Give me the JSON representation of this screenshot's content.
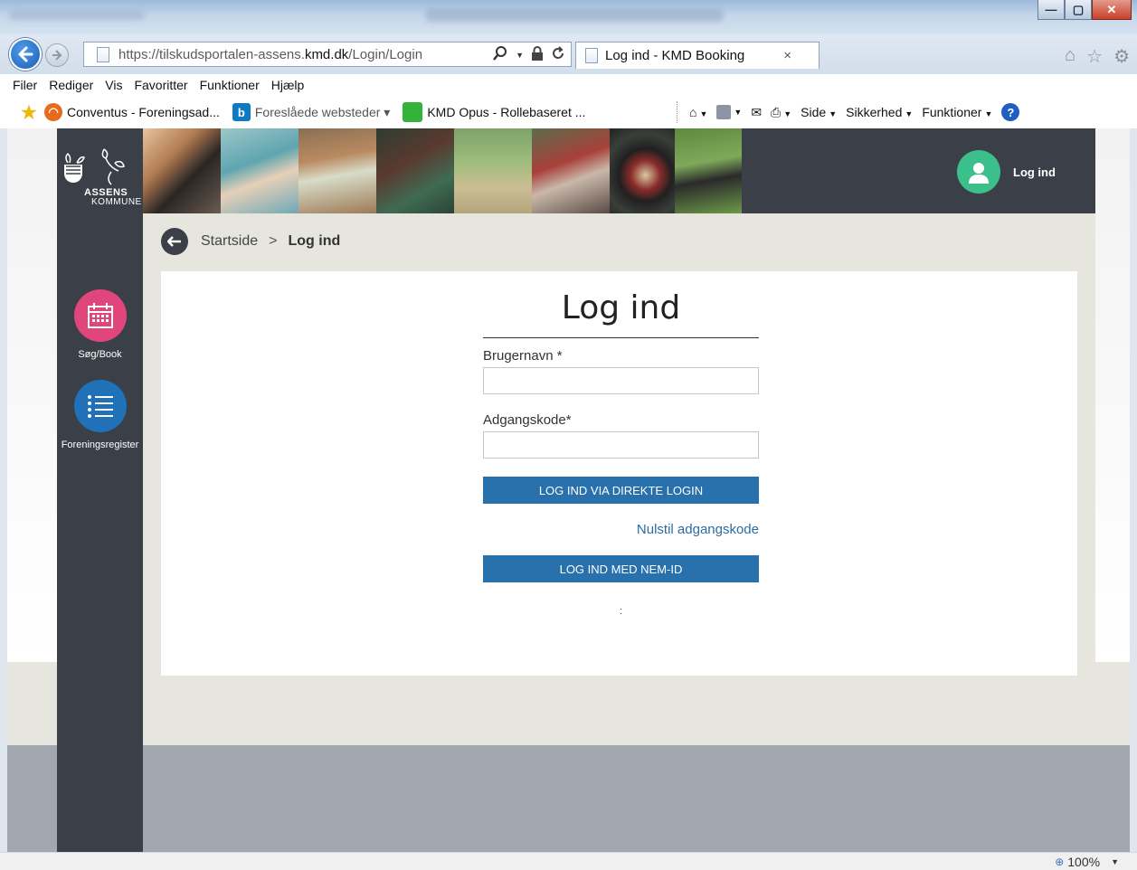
{
  "browser": {
    "url_prefix": "https://tilskudsportalen-assens.",
    "url_domain": "kmd.dk",
    "url_path": "/Login/Login",
    "tab_title": "Log ind - KMD Booking",
    "tab_close": "×",
    "search_glyph": "⚲",
    "menu": [
      "Filer",
      "Rediger",
      "Vis",
      "Favoritter",
      "Funktioner",
      "Hjælp"
    ],
    "favorites": [
      {
        "label": "Conventus - Foreningsad...",
        "icon": "conventus-icon",
        "color": "#e86a1a"
      },
      {
        "label": "Foreslåede websteder ▾",
        "icon": "bing-icon",
        "color": "#0f7ac0"
      },
      {
        "label": "KMD Opus - Rollebaseret ...",
        "icon": "kmd-icon",
        "color": "#33b33a"
      }
    ],
    "tools": {
      "side": "Side",
      "sikkerhed": "Sikkerhed",
      "funktioner": "Funktioner"
    },
    "zoom": "100%"
  },
  "site": {
    "logo_line1": "ASSENS",
    "logo_line2": "KOMMUNE",
    "login_link": "Log ind",
    "nav": [
      {
        "label": "Søg/Book",
        "icon": "calendar-icon",
        "color": "#e0467c"
      },
      {
        "label": "Foreningsregister",
        "icon": "list-icon",
        "color": "#2071b8"
      }
    ]
  },
  "breadcrumb": {
    "home": "Startside",
    "separator": ">",
    "current": "Log ind"
  },
  "login": {
    "title": "Log ind",
    "username_label": "Brugernavn *",
    "username_value": "",
    "password_label": "Adgangskode*",
    "password_value": "",
    "direct_login_button": "LOG IND VIA DIREKTE LOGIN",
    "reset_link": "Nulstil adgangskode",
    "nemid_button": "LOG IND MED NEM-ID",
    "footer_colon": ":"
  },
  "colors": {
    "sidebar": "#3b4048",
    "button": "#2871ac",
    "link": "#2b6ca3",
    "avatar": "#3bbf8b"
  }
}
